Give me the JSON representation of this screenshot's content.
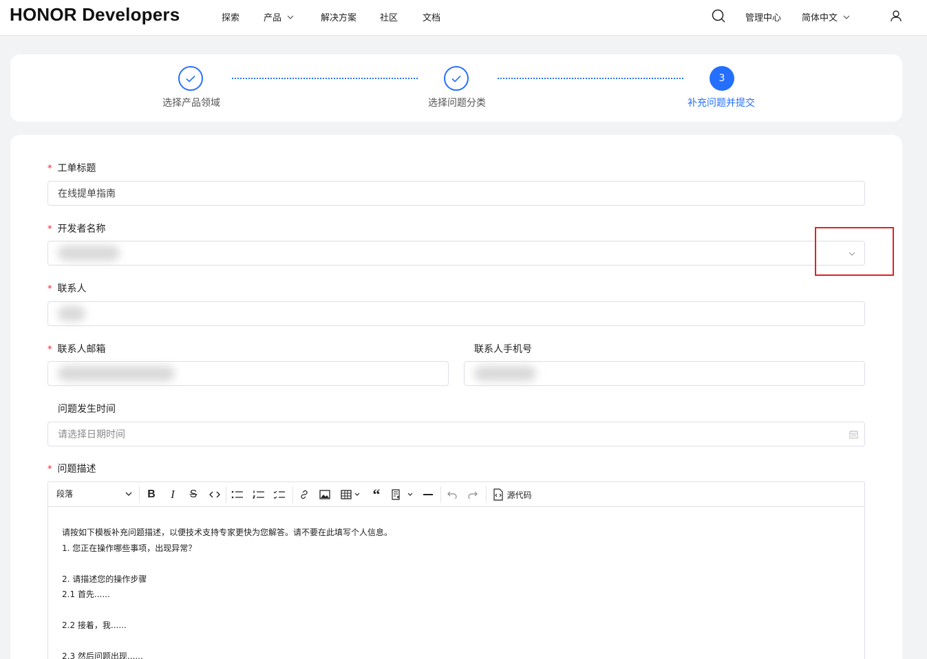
{
  "header": {
    "logo": "HONOR Developers",
    "nav": [
      "探索",
      "产品",
      "解决方案",
      "社区",
      "文档"
    ],
    "admin_label": "管理中心",
    "lang_label": "简体中文"
  },
  "steps": [
    {
      "label": "选择产品领域",
      "state": "done"
    },
    {
      "label": "选择问题分类",
      "state": "done"
    },
    {
      "label": "补充问题并提交",
      "number": "3",
      "state": "active"
    }
  ],
  "form": {
    "title_label": "工单标题",
    "title_value": "在线提单指南",
    "developer_label": "开发者名称",
    "contact_label": "联系人",
    "email_label": "联系人邮箱",
    "phone_label": "联系人手机号",
    "time_label": "问题发生时间",
    "time_placeholder": "请选择日期时间",
    "desc_label": "问题描述",
    "required_mark": "*"
  },
  "editor": {
    "block_format": "段落",
    "source_label": "源代码",
    "lines": [
      "请按如下模板补充问题描述，以便技术支持专家更快为您解答。请不要在此填写个人信息。",
      "1. 您正在操作哪些事项，出现异常？",
      "",
      "2. 请描述您的操作步骤",
      "2.1 首先......",
      "",
      "2.2 接着，我......",
      "",
      "2.3 然后问题出现......"
    ]
  },
  "colors": {
    "accent": "#256fff",
    "required": "#f5222d",
    "highlight": "#e02020"
  }
}
